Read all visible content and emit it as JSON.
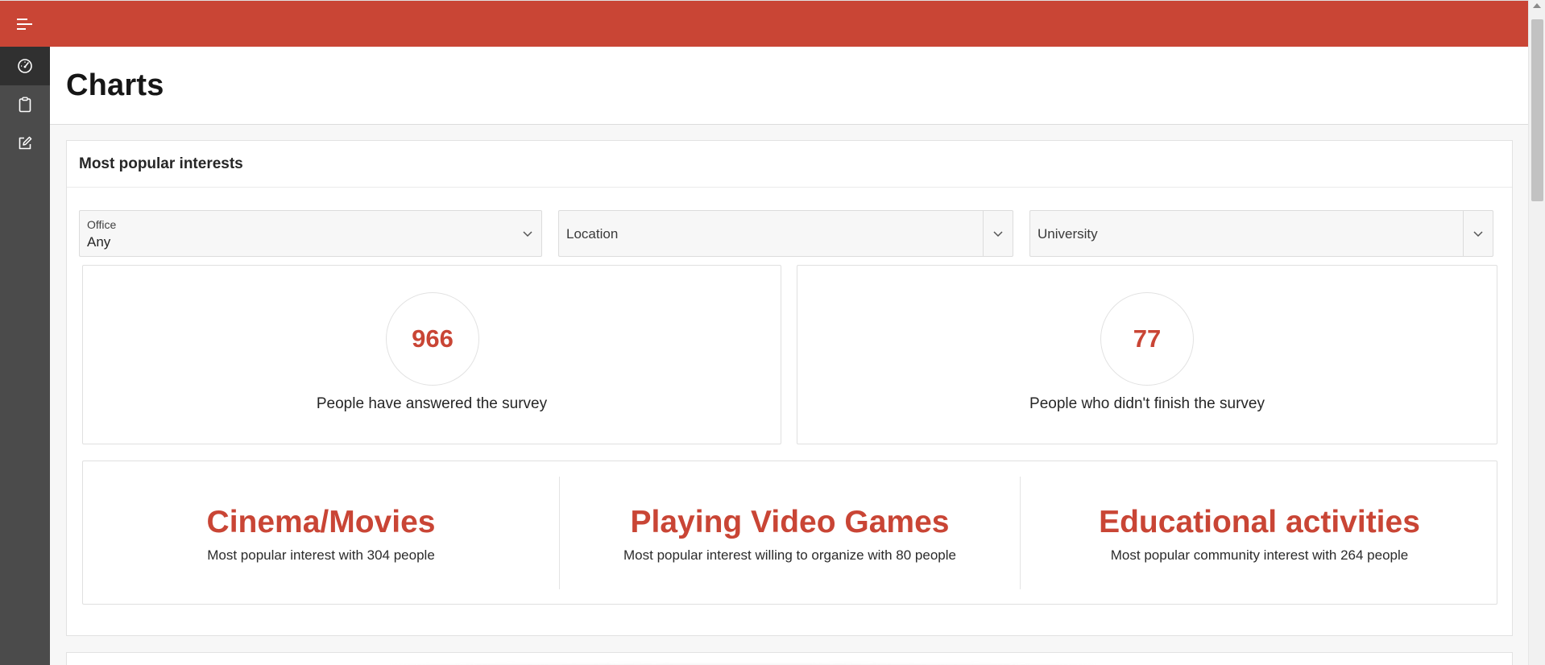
{
  "page": {
    "title": "Charts"
  },
  "sidebar": {
    "items": [
      {
        "icon": "dashboard-gauge-icon",
        "active": true
      },
      {
        "icon": "clipboard-icon",
        "active": false
      },
      {
        "icon": "edit-icon",
        "active": false
      }
    ]
  },
  "region": {
    "title": "Most popular interests"
  },
  "filters": {
    "office": {
      "label": "Office",
      "value": "Any"
    },
    "location": {
      "placeholder": "Location"
    },
    "university": {
      "placeholder": "University"
    }
  },
  "stats": [
    {
      "value": "966",
      "label": "People have answered the survey"
    },
    {
      "value": "77",
      "label": "People who didn't finish the survey"
    }
  ],
  "highlights": [
    {
      "title": "Cinema/Movies",
      "subtitle": "Most popular interest with 304 people"
    },
    {
      "title": "Playing Video Games",
      "subtitle": "Most popular interest willing to organize with 80 people"
    },
    {
      "title": "Educational activities",
      "subtitle": "Most popular community interest with 264 people"
    }
  ],
  "colors": {
    "accent": "#c94535",
    "sidebar": "#4b4b4b",
    "sidebar_active": "#303030"
  }
}
